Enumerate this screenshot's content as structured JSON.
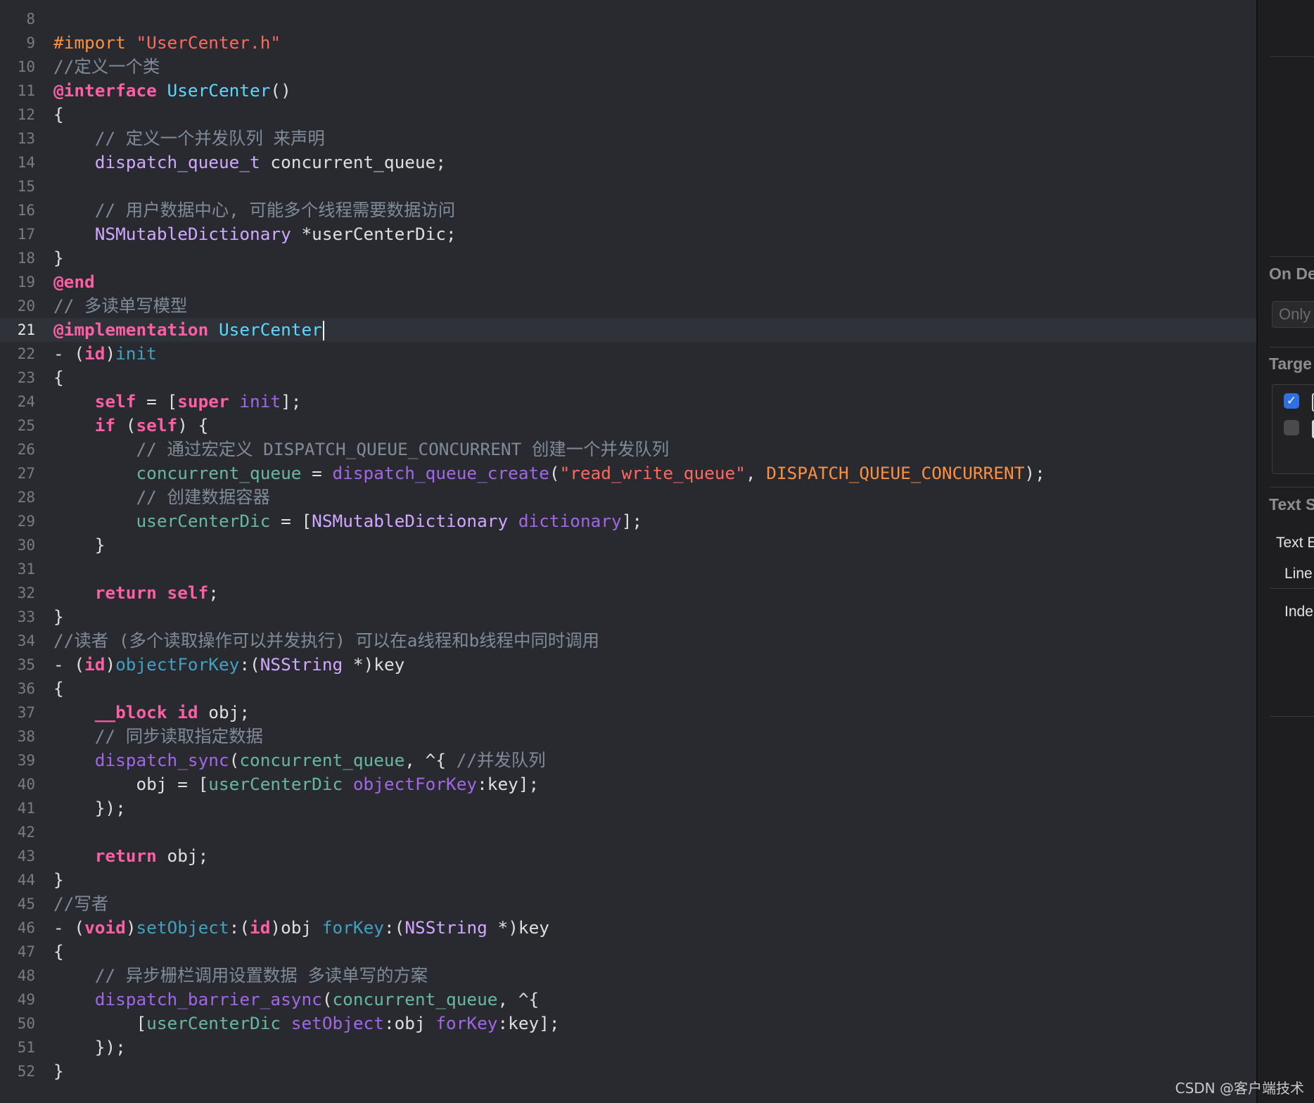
{
  "editor": {
    "current_line": "21",
    "lines": [
      {
        "n": "8",
        "tokens": []
      },
      {
        "n": "9",
        "tokens": [
          {
            "t": "#import",
            "c": "pre"
          },
          {
            "t": " "
          },
          {
            "t": "\"UserCenter.h\"",
            "c": "str"
          }
        ]
      },
      {
        "n": "10",
        "tokens": [
          {
            "t": "//定义一个类",
            "c": "com"
          }
        ]
      },
      {
        "n": "11",
        "tokens": [
          {
            "t": "@interface",
            "c": "kw"
          },
          {
            "t": " "
          },
          {
            "t": "UserCenter",
            "c": "cls"
          },
          {
            "t": "()"
          }
        ]
      },
      {
        "n": "12",
        "tokens": [
          {
            "t": "{"
          }
        ]
      },
      {
        "n": "13",
        "tokens": [
          {
            "t": "    "
          },
          {
            "t": "// 定义一个并发队列 来声明",
            "c": "com"
          }
        ]
      },
      {
        "n": "14",
        "tokens": [
          {
            "t": "    "
          },
          {
            "t": "dispatch_queue_t",
            "c": "type"
          },
          {
            "t": " concurrent_queue;"
          }
        ]
      },
      {
        "n": "15",
        "tokens": []
      },
      {
        "n": "16",
        "tokens": [
          {
            "t": "    "
          },
          {
            "t": "// 用户数据中心, 可能多个线程需要数据访问",
            "c": "com"
          }
        ]
      },
      {
        "n": "17",
        "tokens": [
          {
            "t": "    "
          },
          {
            "t": "NSMutableDictionary",
            "c": "type"
          },
          {
            "t": " *userCenterDic;"
          }
        ]
      },
      {
        "n": "18",
        "tokens": [
          {
            "t": "}"
          }
        ]
      },
      {
        "n": "19",
        "tokens": [
          {
            "t": "@end",
            "c": "kw"
          }
        ]
      },
      {
        "n": "20",
        "tokens": [
          {
            "t": "// 多读单写模型",
            "c": "com"
          }
        ]
      },
      {
        "n": "21",
        "tokens": [
          {
            "t": "@implementation",
            "c": "kw"
          },
          {
            "t": " "
          },
          {
            "t": "UserCenter",
            "c": "cls"
          }
        ]
      },
      {
        "n": "22",
        "tokens": [
          {
            "t": "- ("
          },
          {
            "t": "id",
            "c": "kw"
          },
          {
            "t": ")"
          },
          {
            "t": "init",
            "c": "fn"
          }
        ]
      },
      {
        "n": "23",
        "tokens": [
          {
            "t": "{"
          }
        ]
      },
      {
        "n": "24",
        "tokens": [
          {
            "t": "    "
          },
          {
            "t": "self",
            "c": "kw"
          },
          {
            "t": " = ["
          },
          {
            "t": "super",
            "c": "kw"
          },
          {
            "t": " "
          },
          {
            "t": "init",
            "c": "lib"
          },
          {
            "t": "];"
          }
        ]
      },
      {
        "n": "25",
        "tokens": [
          {
            "t": "    "
          },
          {
            "t": "if",
            "c": "kw"
          },
          {
            "t": " ("
          },
          {
            "t": "self",
            "c": "kw"
          },
          {
            "t": ") {"
          }
        ]
      },
      {
        "n": "26",
        "tokens": [
          {
            "t": "        "
          },
          {
            "t": "// 通过宏定义 DISPATCH_QUEUE_CONCURRENT 创建一个并发队列",
            "c": "com"
          }
        ]
      },
      {
        "n": "27",
        "tokens": [
          {
            "t": "        "
          },
          {
            "t": "concurrent_queue",
            "c": "var"
          },
          {
            "t": " = "
          },
          {
            "t": "dispatch_queue_create",
            "c": "lib"
          },
          {
            "t": "("
          },
          {
            "t": "\"read_write_queue\"",
            "c": "str"
          },
          {
            "t": ", "
          },
          {
            "t": "DISPATCH_QUEUE_CONCURRENT",
            "c": "mac"
          },
          {
            "t": ");"
          }
        ]
      },
      {
        "n": "28",
        "tokens": [
          {
            "t": "        "
          },
          {
            "t": "// 创建数据容器",
            "c": "com"
          }
        ]
      },
      {
        "n": "29",
        "tokens": [
          {
            "t": "        "
          },
          {
            "t": "userCenterDic",
            "c": "var"
          },
          {
            "t": " = ["
          },
          {
            "t": "NSMutableDictionary",
            "c": "type"
          },
          {
            "t": " "
          },
          {
            "t": "dictionary",
            "c": "lib"
          },
          {
            "t": "];"
          }
        ]
      },
      {
        "n": "30",
        "tokens": [
          {
            "t": "    }"
          }
        ]
      },
      {
        "n": "31",
        "tokens": []
      },
      {
        "n": "32",
        "tokens": [
          {
            "t": "    "
          },
          {
            "t": "return",
            "c": "kw"
          },
          {
            "t": " "
          },
          {
            "t": "self",
            "c": "kw"
          },
          {
            "t": ";"
          }
        ]
      },
      {
        "n": "33",
        "tokens": [
          {
            "t": "}"
          }
        ]
      },
      {
        "n": "34",
        "tokens": [
          {
            "t": "//读者 (多个读取操作可以并发执行) 可以在a线程和b线程中同时调用",
            "c": "com"
          }
        ]
      },
      {
        "n": "35",
        "tokens": [
          {
            "t": "- ("
          },
          {
            "t": "id",
            "c": "kw"
          },
          {
            "t": ")"
          },
          {
            "t": "objectForKey",
            "c": "fn"
          },
          {
            "t": ":("
          },
          {
            "t": "NSString",
            "c": "type"
          },
          {
            "t": " *)key"
          }
        ]
      },
      {
        "n": "36",
        "tokens": [
          {
            "t": "{"
          }
        ]
      },
      {
        "n": "37",
        "tokens": [
          {
            "t": "    "
          },
          {
            "t": "__block",
            "c": "kw"
          },
          {
            "t": " "
          },
          {
            "t": "id",
            "c": "kw"
          },
          {
            "t": " obj;"
          }
        ]
      },
      {
        "n": "38",
        "tokens": [
          {
            "t": "    "
          },
          {
            "t": "// 同步读取指定数据",
            "c": "com"
          }
        ]
      },
      {
        "n": "39",
        "tokens": [
          {
            "t": "    "
          },
          {
            "t": "dispatch_sync",
            "c": "lib"
          },
          {
            "t": "("
          },
          {
            "t": "concurrent_queue",
            "c": "var"
          },
          {
            "t": ", ^{ "
          },
          {
            "t": "//并发队列",
            "c": "com"
          }
        ]
      },
      {
        "n": "40",
        "tokens": [
          {
            "t": "        obj = ["
          },
          {
            "t": "userCenterDic",
            "c": "var"
          },
          {
            "t": " "
          },
          {
            "t": "objectForKey",
            "c": "lib"
          },
          {
            "t": ":key];"
          }
        ]
      },
      {
        "n": "41",
        "tokens": [
          {
            "t": "    });"
          }
        ]
      },
      {
        "n": "42",
        "tokens": []
      },
      {
        "n": "43",
        "tokens": [
          {
            "t": "    "
          },
          {
            "t": "return",
            "c": "kw"
          },
          {
            "t": " obj;"
          }
        ]
      },
      {
        "n": "44",
        "tokens": [
          {
            "t": "}"
          }
        ]
      },
      {
        "n": "45",
        "tokens": [
          {
            "t": "//写者",
            "c": "com"
          }
        ]
      },
      {
        "n": "46",
        "tokens": [
          {
            "t": "- ("
          },
          {
            "t": "void",
            "c": "kw"
          },
          {
            "t": ")"
          },
          {
            "t": "setObject",
            "c": "fn"
          },
          {
            "t": ":("
          },
          {
            "t": "id",
            "c": "kw"
          },
          {
            "t": ")obj "
          },
          {
            "t": "forKey",
            "c": "fn"
          },
          {
            "t": ":("
          },
          {
            "t": "NSString",
            "c": "type"
          },
          {
            "t": " *)key"
          }
        ]
      },
      {
        "n": "47",
        "tokens": [
          {
            "t": "{"
          }
        ]
      },
      {
        "n": "48",
        "tokens": [
          {
            "t": "    "
          },
          {
            "t": "// 异步栅栏调用设置数据 多读单写的方案",
            "c": "com"
          }
        ]
      },
      {
        "n": "49",
        "tokens": [
          {
            "t": "    "
          },
          {
            "t": "dispatch_barrier_async",
            "c": "lib"
          },
          {
            "t": "("
          },
          {
            "t": "concurrent_queue",
            "c": "var"
          },
          {
            "t": ", ^{"
          }
        ]
      },
      {
        "n": "50",
        "tokens": [
          {
            "t": "        ["
          },
          {
            "t": "userCenterDic",
            "c": "var"
          },
          {
            "t": " "
          },
          {
            "t": "setObject",
            "c": "lib"
          },
          {
            "t": ":obj "
          },
          {
            "t": "forKey",
            "c": "lib"
          },
          {
            "t": ":key];"
          }
        ]
      },
      {
        "n": "51",
        "tokens": [
          {
            "t": "    });"
          }
        ]
      },
      {
        "n": "52",
        "tokens": [
          {
            "t": "}"
          }
        ]
      }
    ]
  },
  "inspector": {
    "on_demand_heading": "On De",
    "on_demand_field": "Only",
    "target_heading": "Targe",
    "targets": [
      {
        "checked": true,
        "icon": "target-app-icon"
      },
      {
        "checked": false,
        "icon": "target-file-icon"
      }
    ],
    "text_settings_heading": "Text S",
    "text_encoding_label": "Text E",
    "line_endings_label": "Line",
    "indent_label": "Inde"
  },
  "watermark": "CSDN @客户端技术"
}
